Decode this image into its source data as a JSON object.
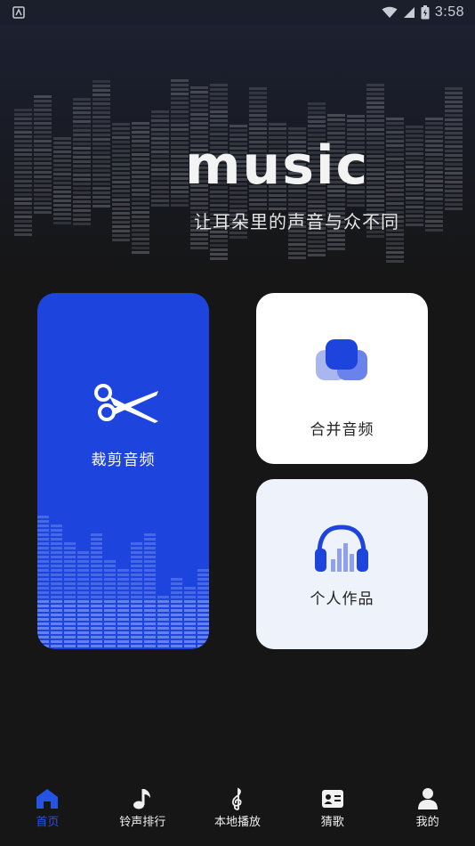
{
  "status_bar": {
    "time": "3:58",
    "app_indicator": "notification-icon"
  },
  "banner": {
    "title": "music",
    "slogan": "让耳朵里的声音与众不同"
  },
  "cards": {
    "cut": {
      "label": "裁剪音频",
      "icon": "scissors-icon",
      "color": "#1d44dc"
    },
    "merge": {
      "label": "合并音频",
      "icon": "merge-icon",
      "color": "#ffffff"
    },
    "works": {
      "label": "个人作品",
      "icon": "headphones-icon",
      "color": "#eef2fb"
    }
  },
  "bottom_nav": {
    "active_color": "#2553e8",
    "items": [
      {
        "label": "首页",
        "icon": "home-icon",
        "active": true
      },
      {
        "label": "铃声排行",
        "icon": "music-note-icon",
        "active": false
      },
      {
        "label": "本地播放",
        "icon": "treble-clef-icon",
        "active": false
      },
      {
        "label": "猜歌",
        "icon": "id-card-icon",
        "active": false
      },
      {
        "label": "我的",
        "icon": "profile-icon",
        "active": false
      }
    ]
  }
}
